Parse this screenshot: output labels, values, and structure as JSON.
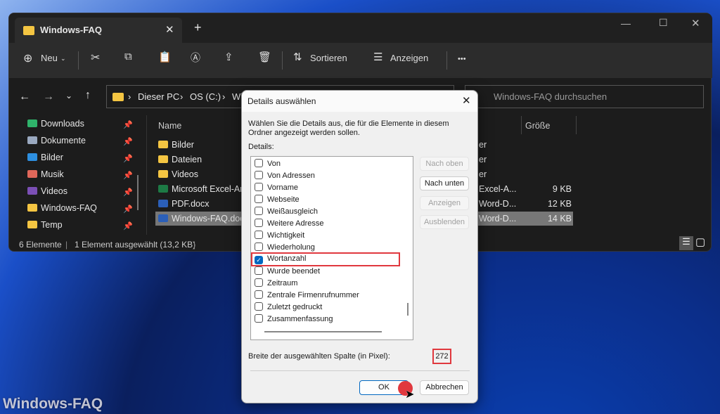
{
  "window": {
    "tab_title": "Windows-FAQ",
    "new_tab": "+"
  },
  "toolbar": {
    "new": "Neu",
    "sort": "Sortieren",
    "view": "Anzeigen",
    "more": "•••"
  },
  "address": {
    "crumbs": [
      "Dieser PC",
      "OS (C:)",
      "Wi"
    ]
  },
  "search": {
    "placeholder": "Windows-FAQ durchsuchen"
  },
  "sidebar": {
    "items": [
      {
        "label": "Downloads",
        "icon": "download-icon",
        "color": "#2fb36b"
      },
      {
        "label": "Dokumente",
        "icon": "document-icon",
        "color": "#9aa9c0"
      },
      {
        "label": "Bilder",
        "icon": "pictures-icon",
        "color": "#2d8fe0"
      },
      {
        "label": "Musik",
        "icon": "music-icon",
        "color": "#e0675a"
      },
      {
        "label": "Videos",
        "icon": "videos-icon",
        "color": "#7b4fb5"
      },
      {
        "label": "Windows-FAQ",
        "icon": "folder-icon",
        "color": "#f4c542"
      },
      {
        "label": "Temp",
        "icon": "folder-icon",
        "color": "#f4c542"
      }
    ]
  },
  "columns": {
    "name": "Name",
    "size": "Größe"
  },
  "files": [
    {
      "name": "Bilder",
      "type": "er",
      "size": "",
      "icon": "folder"
    },
    {
      "name": "Dateien",
      "type": "er",
      "size": "",
      "icon": "folder"
    },
    {
      "name": "Videos",
      "type": "er",
      "size": "",
      "icon": "folder"
    },
    {
      "name": "Microsoft Excel-Ar",
      "type": "Excel-A...",
      "size": "9 KB",
      "icon": "excel"
    },
    {
      "name": "PDF.docx",
      "type": "Word-D...",
      "size": "12 KB",
      "icon": "word"
    },
    {
      "name": "Windows-FAQ.doc",
      "type": "Word-D...",
      "size": "14 KB",
      "icon": "word",
      "selected": true
    }
  ],
  "status": {
    "count": "6 Elemente",
    "selected": "1 Element ausgewählt (13,2 KB)"
  },
  "dialog": {
    "title": "Details auswählen",
    "description": "Wählen Sie die Details aus, die für die Elemente in diesem Ordner angezeigt werden sollen.",
    "details_label": "Details:",
    "items": [
      {
        "label": "Von",
        "checked": false
      },
      {
        "label": "Von Adressen",
        "checked": false
      },
      {
        "label": "Vorname",
        "checked": false
      },
      {
        "label": "Webseite",
        "checked": false
      },
      {
        "label": "Weißausgleich",
        "checked": false
      },
      {
        "label": "Weitere Adresse",
        "checked": false
      },
      {
        "label": "Wichtigkeit",
        "checked": false
      },
      {
        "label": "Wiederholung",
        "checked": false
      },
      {
        "label": "Wortanzahl",
        "checked": true
      },
      {
        "label": "Wurde beendet",
        "checked": false
      },
      {
        "label": "Zeitraum",
        "checked": false
      },
      {
        "label": "Zentrale Firmenrufnummer",
        "checked": false
      },
      {
        "label": "Zuletzt gedruckt",
        "checked": false
      },
      {
        "label": "Zusammenfassung",
        "checked": false
      }
    ],
    "buttons": {
      "up": "Nach oben",
      "down": "Nach unten",
      "show": "Anzeigen",
      "hide": "Ausblenden",
      "ok": "OK",
      "cancel": "Abbrechen"
    },
    "width_label": "Breite der ausgewählten Spalte (in Pixel):",
    "width_value": "272",
    "highlight_color": "#e0383e"
  },
  "watermark": "Windows-FAQ"
}
